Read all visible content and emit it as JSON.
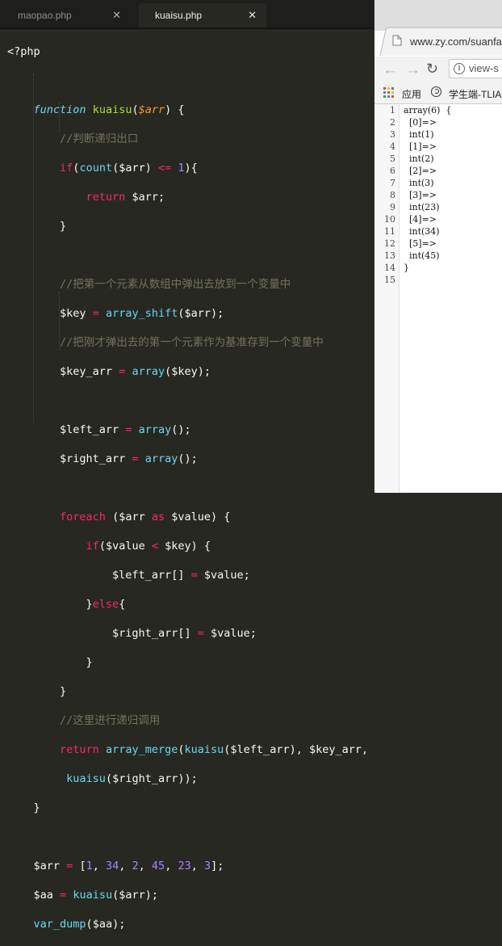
{
  "editor": {
    "tabs": [
      {
        "label": "maopao.php",
        "active": false
      },
      {
        "label": "kuaisu.php",
        "active": true
      }
    ],
    "close_glyph": "✕",
    "code": {
      "open_tag": "<?php",
      "kw_function": "function",
      "func_name": "kuaisu",
      "param_arr": "$arr",
      "comment_recursion_exit": "//判断递归出口",
      "kw_if": "if",
      "fn_count": "count",
      "op_le": "<=",
      "num_1": "1",
      "kw_return": "return",
      "ret_arr": "$arr;",
      "comment_pop_first": "//把第一个元素从数组中弹出去放到一个变量中",
      "var_key": "$key",
      "fn_array_shift": "array_shift",
      "comment_pivot": "//把刚才弹出去的第一个元素作为基准存到一个变量中",
      "var_key_arr": "$key_arr",
      "fn_array": "array",
      "var_left_arr": "$left_arr",
      "var_right_arr": "$right_arr",
      "kw_foreach": "foreach",
      "kw_as": "as",
      "var_value": "$value",
      "op_lt": "<",
      "kw_else": "else",
      "comment_recurse": "//这里进行递归调用",
      "fn_array_merge": "array_merge",
      "var_arr": "$arr",
      "num_34": "34",
      "num_2": "2",
      "num_45": "45",
      "num_23": "23",
      "num_3": "3",
      "var_aa": "$aa",
      "fn_var_dump": "var_dump"
    }
  },
  "browser": {
    "tab_title": "www.zy.com/suanfa",
    "omnibox_text": "view-s",
    "bookmarks": [
      {
        "label": "应用"
      },
      {
        "label": "学生端-TLIA"
      }
    ],
    "line_numbers": [
      "1",
      "2",
      "3",
      "4",
      "5",
      "6",
      "7",
      "8",
      "9",
      "10",
      "11",
      "12",
      "13",
      "14",
      "15"
    ],
    "dump_lines": [
      "array(6)  {",
      "  [0]=>",
      "  int(1)",
      "  [1]=>",
      "  int(2)",
      "  [2]=>",
      "  int(3)",
      "  [3]=>",
      "  int(23)",
      "  [4]=>",
      "  int(34)",
      "  [5]=>",
      "  int(45)",
      "}",
      ""
    ]
  },
  "colors": {
    "editor_bg": "#272822",
    "keyword": "#f92672",
    "builtin": "#66d9ef",
    "function_name": "#a6e22e",
    "parameter": "#fd971f",
    "number": "#ae81ff",
    "comment": "#75715e"
  }
}
